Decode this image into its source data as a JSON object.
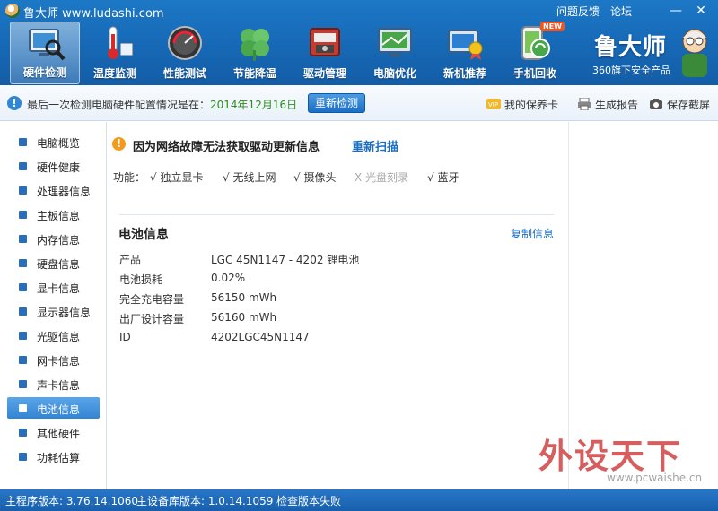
{
  "app": {
    "title": "鲁大师 www.ludashi.com",
    "links": {
      "feedback": "问题反馈",
      "forum": "论坛"
    },
    "window_controls": {
      "minimize": "—",
      "close": "✕"
    }
  },
  "toolbar": [
    {
      "label": "硬件检测",
      "icon": "hardware-detect-icon",
      "active": true
    },
    {
      "label": "温度监测",
      "icon": "thermometer-icon",
      "active": false
    },
    {
      "label": "性能测试",
      "icon": "speedometer-icon",
      "active": false
    },
    {
      "label": "节能降温",
      "icon": "clover-icon",
      "active": false
    },
    {
      "label": "驱动管理",
      "icon": "driver-chip-icon",
      "active": false
    },
    {
      "label": "电脑优化",
      "icon": "optimize-monitor-icon",
      "active": false
    },
    {
      "label": "新机推荐",
      "icon": "new-pc-icon",
      "active": false
    },
    {
      "label": "手机回收",
      "icon": "phone-recycle-icon",
      "active": false,
      "badge": "NEW"
    }
  ],
  "brand": {
    "name": "鲁大师",
    "subtitle": "360旗下安全产品"
  },
  "info_bar": {
    "text": "最后一次检测电脑硬件配置情况是在：",
    "date": "2014年12月16日",
    "recheck_button": "重新检测",
    "warranty_card": "我的保养卡",
    "generate_report": "生成报告",
    "save_screenshot": "保存截屏"
  },
  "sidebar": {
    "items": [
      {
        "label": "电脑概览",
        "active": false
      },
      {
        "label": "硬件健康",
        "active": false
      },
      {
        "label": "处理器信息",
        "active": false
      },
      {
        "label": "主板信息",
        "active": false
      },
      {
        "label": "内存信息",
        "active": false
      },
      {
        "label": "硬盘信息",
        "active": false
      },
      {
        "label": "显卡信息",
        "active": false
      },
      {
        "label": "显示器信息",
        "active": false
      },
      {
        "label": "光驱信息",
        "active": false
      },
      {
        "label": "网卡信息",
        "active": false
      },
      {
        "label": "声卡信息",
        "active": false
      },
      {
        "label": "电池信息",
        "active": true
      },
      {
        "label": "其他硬件",
        "active": false
      },
      {
        "label": "功耗估算",
        "active": false
      }
    ]
  },
  "main": {
    "warning": "因为网络故障无法获取驱动更新信息",
    "rescan_link": "重新扫描",
    "features_label": "功能：",
    "features": [
      {
        "label": "√  独立显卡",
        "available": true
      },
      {
        "label": "√  无线上网",
        "available": true
      },
      {
        "label": "√  摄像头",
        "available": true
      },
      {
        "label": "X  光盘刻录",
        "available": false
      },
      {
        "label": "√  蓝牙",
        "available": true
      }
    ],
    "section_title": "电池信息",
    "copy_link": "复制信息",
    "rows": [
      {
        "key": "产品",
        "value": "LGC 45N1147 -   4202 锂电池"
      },
      {
        "key": "电池损耗",
        "value": "0.02%"
      },
      {
        "key": "完全充电容量",
        "value": "56150 mWh"
      },
      {
        "key": "出厂设计容量",
        "value": "56160 mWh"
      },
      {
        "key": "ID",
        "value": "4202LGC45N1147"
      }
    ]
  },
  "watermark": {
    "big": "外设天下",
    "small": "www.pcwaishe.cn"
  },
  "status_bar": {
    "main_version": "主程序版本: 3.76.14.1060",
    "db_version": "主设备库版本: 1.0.14.1059",
    "check_version": "检查版本失败"
  },
  "colors": {
    "header_blue": "#1667b4",
    "accent_green": "#2f8b1f",
    "link_blue": "#1a6fc4",
    "warning_orange": "#f39a1c"
  }
}
